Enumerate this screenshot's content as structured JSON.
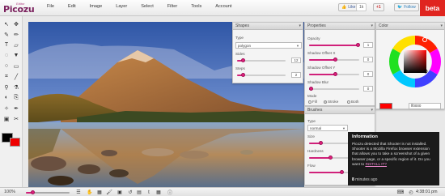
{
  "app": {
    "logo": "Picozu",
    "logo_sub": "Editor",
    "beta_label": "beta"
  },
  "menu": [
    "File",
    "Edit",
    "Image",
    "Layer",
    "Select",
    "Filter",
    "Tools",
    "Account"
  ],
  "social": {
    "like_label": "Like",
    "like_count": "1k",
    "gplus_label": "+1",
    "follow_label": "Follow"
  },
  "colors": {
    "accent": "#d0207a",
    "beta": "#e0251f",
    "foreground": "#000000",
    "background": "#e00000"
  },
  "tools": [
    "select-icon",
    "move-icon",
    "brush-icon",
    "pencil-icon",
    "text-icon",
    "eraser-icon",
    "lasso-icon",
    "fill-icon",
    "ellipse-icon",
    "rect-icon",
    "crop-icon",
    "line-icon",
    "zoom-icon",
    "eyedropper-icon",
    "blur-icon",
    "clone-icon",
    "wand-icon",
    "pen-icon",
    "image-icon",
    "scissors-icon"
  ],
  "shapes_panel": {
    "title": "Shapes",
    "type_label": "Type",
    "type_value": "polygon",
    "sides_label": "Sides",
    "sides_value": "12",
    "steps_label": "Steps",
    "steps_value": "2"
  },
  "properties_panel": {
    "title": "Properties",
    "opacity_label": "Opacity",
    "opacity_value": "1",
    "shadow_x_label": "Shadow Offset X",
    "shadow_x_value": "0",
    "shadow_y_label": "Shadow Offset Y",
    "shadow_y_value": "0",
    "shadow_blur_label": "Shadow Blur",
    "shadow_blur_value": "0",
    "mode_label": "Mode",
    "mode_options": [
      "Fill",
      "Stroke",
      "Both"
    ],
    "mode_selected": "Stroke"
  },
  "color_panel": {
    "title": "Color",
    "hex_value": "ff0000"
  },
  "brushes_panel": {
    "title": "Brushes",
    "type_label": "Type",
    "type_value": "normal",
    "size_label": "Size",
    "size_value": "30",
    "hardness_label": "Hardness",
    "flow_label": "Flow"
  },
  "info": {
    "title": "Information",
    "body": "Picozu detected that Shooter is not installed. Shooter is a Mozilla Firefox browser extension that allows you to take a screenshot of a given browser page, or a specific region of it.",
    "link_prefix": "Do you want to",
    "link_text": "INSTALL IT?",
    "ago_num": "8",
    "ago_text": "minutes ago"
  },
  "status": {
    "zoom": "100%",
    "time": "4:38:01 pm"
  }
}
